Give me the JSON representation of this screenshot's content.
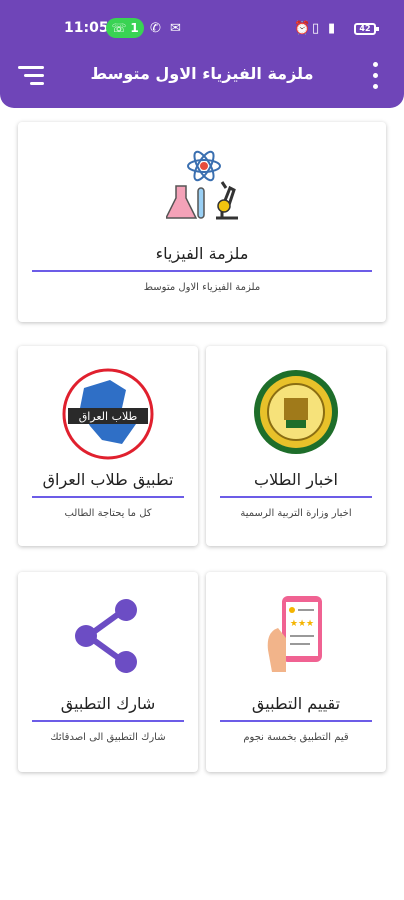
{
  "status_bar": {
    "time": "11:05",
    "badge_count": "1",
    "battery": "42"
  },
  "app_bar": {
    "title": "ملزمة الفيزياء الاول متوسط",
    "menu_icon": "menu-icon",
    "more_icon": "more-vert-icon",
    "color": "#6f45b8"
  },
  "cards": {
    "main": {
      "title": "ملزمة الفيزياء",
      "subtitle": "ملزمة الفيزياء الاول متوسط",
      "icon": "science-lab-icon"
    },
    "news": {
      "title": "اخبار الطلاب",
      "subtitle": "اخبار وزارة التربية الرسمية",
      "icon": "ministry-logo-icon"
    },
    "iraq_app": {
      "title": "تطبيق طلاب العراق",
      "subtitle": "كل ما يحتاجة الطالب",
      "icon": "iraq-map-icon",
      "logo_text": "طلاب العراق"
    },
    "rate": {
      "title": "تقييم التطبيق",
      "subtitle": "قيم التطبيق بخمسة نجوم",
      "icon": "rate-phone-icon"
    },
    "share": {
      "title": "شارك التطبيق",
      "subtitle": "شارك التطبيق الى اصدقائك",
      "icon": "share-icon"
    }
  },
  "accent": "#6c5ce7"
}
